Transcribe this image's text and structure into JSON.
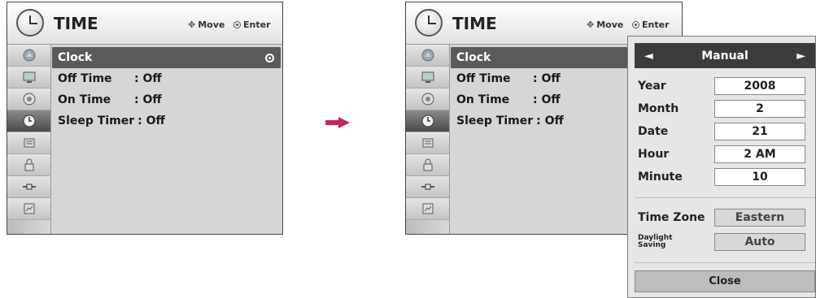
{
  "menu_title": "TIME",
  "hints": {
    "move": "Move",
    "enter": "Enter"
  },
  "sidebar_icons": [
    "picture-icon",
    "screen-icon",
    "audio-icon",
    "time-icon",
    "option-icon",
    "lock-icon",
    "input-icon",
    "usb-icon"
  ],
  "items": [
    {
      "label": "Clock",
      "value": ""
    },
    {
      "label": "Off Time",
      "value": ": Off"
    },
    {
      "label": "On Time",
      "value": ": Off"
    },
    {
      "label": "Sleep Timer",
      "value": ": Off"
    }
  ],
  "popup": {
    "mode": "Manual",
    "fields": [
      {
        "label": "Year",
        "value": "2008"
      },
      {
        "label": "Month",
        "value": "2"
      },
      {
        "label": "Date",
        "value": "21"
      },
      {
        "label": "Hour",
        "value": "2 AM"
      },
      {
        "label": "Minute",
        "value": "10"
      }
    ],
    "time_zone": {
      "label": "Time Zone",
      "value": "Eastern"
    },
    "daylight": {
      "label_1": "Daylight",
      "label_2": "Saving",
      "value": "Auto"
    },
    "close": "Close"
  },
  "colors": {
    "arrow": "#c8265a",
    "selected_bg": "#5a5a5a",
    "mode_bg": "#3c3c3c"
  }
}
